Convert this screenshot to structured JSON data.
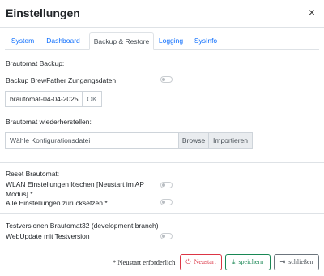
{
  "dialog": {
    "title": "Einstellungen",
    "close_glyph": "×"
  },
  "tabs": [
    {
      "label": "System",
      "active": false
    },
    {
      "label": "Dashboard",
      "active": false
    },
    {
      "label": "Backup & Restore",
      "active": true
    },
    {
      "label": "Logging",
      "active": false
    },
    {
      "label": "SysInfo",
      "active": false
    }
  ],
  "backup": {
    "heading": "Brautomat Backup:",
    "brewfather_label": "Backup BrewFather Zungangsdaten",
    "brewfather_enabled": false,
    "filename_value": "brautomat-04-04-2025",
    "ok_label": "OK"
  },
  "restore": {
    "heading": "Brautomat wiederherstellen:",
    "file_placeholder": "Wähle Konfigurationsdatei",
    "browse_label": "Browse",
    "import_label": "Importieren"
  },
  "reset": {
    "heading": "Reset Brautomat:",
    "wlan_label_line1": "WLAN Einstellungen löschen [Neustart im AP",
    "wlan_label_line2": "Modus] *",
    "wlan_enabled": false,
    "all_label": "Alle Einstellungen zurücksetzen *",
    "all_enabled": false
  },
  "test": {
    "heading": "Testversionen Brautomat32 (development branch)",
    "webupdate_label": "WebUpdate mit Testversion",
    "webupdate_enabled": false
  },
  "footer": {
    "note": "* Neustart erforderlich",
    "restart_label": "Neustart",
    "save_label": "speichern",
    "close_label": "schließen"
  },
  "colors": {
    "tab_link": "#0d6efd",
    "restart": "#dc3545",
    "save": "#198754",
    "close": "#6c757d"
  },
  "icons": {
    "restart": "power-icon",
    "save": "download-icon",
    "close": "sign-out-icon"
  }
}
